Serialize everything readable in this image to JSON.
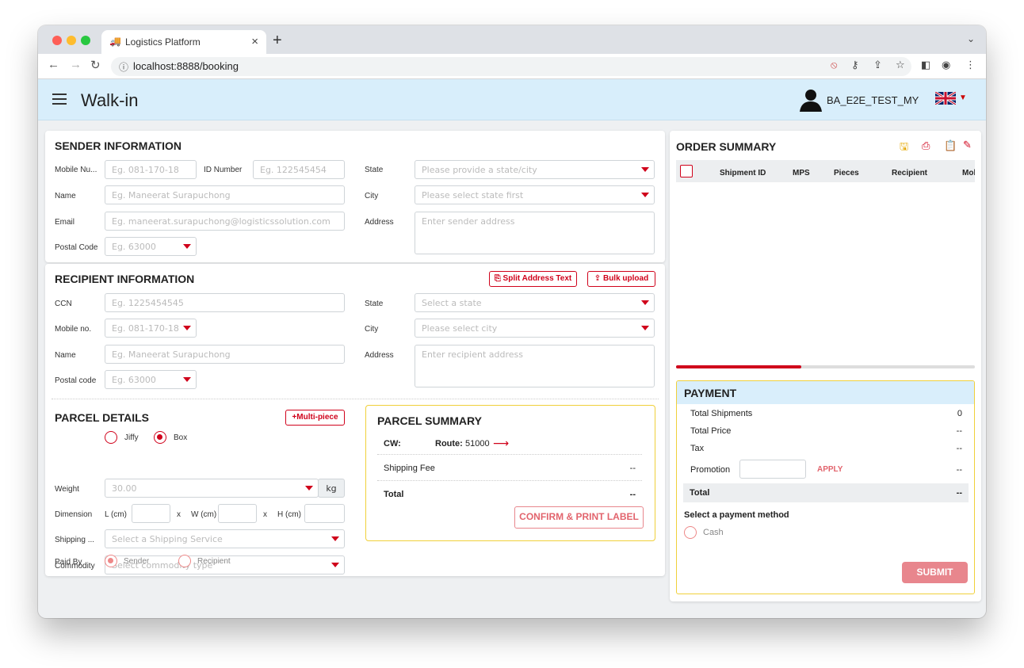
{
  "browser": {
    "tab_title": "Logistics Platform",
    "tab_close": "×",
    "new_tab": "+",
    "url": "localhost:8888/booking"
  },
  "app": {
    "title": "Walk-in",
    "username": "BA_E2E_TEST_MY"
  },
  "sender": {
    "heading": "SENDER INFORMATION",
    "mobile_label": "Mobile Nu...",
    "mobile_placeholder": "Eg. 081-170-18",
    "id_label": "ID Number",
    "id_placeholder": "Eg. 122545454",
    "name_label": "Name",
    "name_placeholder": "Eg. Maneerat Surapuchong",
    "email_label": "Email",
    "email_placeholder": "Eg. maneerat.surapuchong@logisticssolution.com",
    "postal_label": "Postal Code",
    "postal_placeholder": "Eg. 63000",
    "state_label": "State",
    "state_placeholder": "Please provide a state/city",
    "city_label": "City",
    "city_placeholder": "Please select state first",
    "address_label": "Address",
    "address_placeholder": "Enter sender address"
  },
  "recipient": {
    "heading": "RECIPIENT INFORMATION",
    "split_button": "Split Address Text",
    "bulk_button": "Bulk upload",
    "ccn_label": "CCN",
    "ccn_placeholder": "Eg. 1225454545",
    "mobile_label": "Mobile no.",
    "mobile_placeholder": "Eg. 081-170-18",
    "name_label": "Name",
    "name_placeholder": "Eg. Maneerat Surapuchong",
    "postal_label": "Postal code",
    "postal_placeholder": "Eg. 63000",
    "state_label": "State",
    "state_placeholder": "Select a state",
    "city_label": "City",
    "city_placeholder": "Please select city",
    "address_label": "Address",
    "address_placeholder": "Enter recipient address"
  },
  "parcel": {
    "heading": "PARCEL DETAILS",
    "multi_piece": "+Multi-piece",
    "type_jiffy": "Jiffy",
    "type_box": "Box",
    "weight_label": "Weight",
    "weight_value": "30.00",
    "weight_unit": "kg",
    "dimension_label": "Dimension",
    "l_label": "L (cm)",
    "w_label": "W (cm)",
    "h_label": "H (cm)",
    "times": "x",
    "shipping_label": "Shipping ...",
    "shipping_placeholder": "Select a Shipping Service",
    "commodity_label": "Commodity",
    "commodity_placeholder": "Select commodity type",
    "paid_label": "Paid By",
    "paid_sender": "Sender",
    "paid_recipient": "Recipient"
  },
  "parcel_summary": {
    "heading": "PARCEL SUMMARY",
    "cw_label": "CW:",
    "route_label": "Route:",
    "route_value": "51000",
    "shipping_fee_label": "Shipping Fee",
    "shipping_fee_value": "--",
    "total_label": "Total",
    "total_value": "--",
    "confirm_button": "CONFIRM & PRINT LABEL"
  },
  "order_summary": {
    "heading": "ORDER SUMMARY",
    "columns": [
      "Shipment ID",
      "MPS",
      "Pieces",
      "Recipient",
      "Mol"
    ],
    "progress": 0.42
  },
  "payment": {
    "heading": "PAYMENT",
    "total_shipments_label": "Total Shipments",
    "total_shipments_value": "0",
    "total_price_label": "Total Price",
    "total_price_value": "--",
    "tax_label": "Tax",
    "tax_value": "--",
    "promotion_label": "Promotion",
    "apply": "APPLY",
    "promotion_value": "--",
    "total_label": "Total",
    "total_value": "--",
    "method_label": "Select a payment method",
    "cash": "Cash",
    "submit": "SUBMIT"
  },
  "colors": {
    "accent": "#d0021b",
    "appbar": "#d8eefb",
    "payment_header": "#d9eefb",
    "summary_border": "#f0d03a",
    "submit_bg": "#e8868d"
  }
}
